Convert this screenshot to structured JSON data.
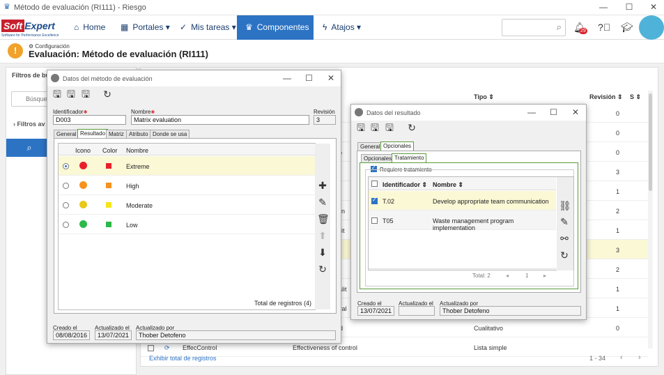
{
  "window": {
    "title": "Método de evaluación (RI111) - Riesgo",
    "minimize": "—",
    "maximize": "☐",
    "close": "✕"
  },
  "nav": {
    "logo_soft": "Soft",
    "logo_expert": "Expert",
    "logo_sub": "Software for Performance Excellence",
    "home": "Home",
    "portales": "Portales",
    "mis_tareas": "Mis tareas",
    "componentes": "Componentes",
    "atajos": "Atajos",
    "notif_count": "29"
  },
  "page": {
    "breadcrumb": "Configuración",
    "title": "Evaluación: Método de evaluación (RI111)"
  },
  "left": {
    "filters_title": "Filtros de bú",
    "search_placeholder": "Búsqued",
    "adv_filters": "Filtros av"
  },
  "grid": {
    "col_tipo": "Tipo",
    "col_revision": "Revisión",
    "col_s": "S",
    "rows": [
      {
        "tipo": "",
        "rev": "0"
      },
      {
        "tipo": "",
        "rev": "0"
      },
      {
        "tipo": "",
        "rev": "0"
      },
      {
        "tipo": "",
        "rev": "3"
      },
      {
        "tipo": "",
        "rev": "1"
      },
      {
        "tipo": "",
        "rev": "2"
      },
      {
        "tipo": "",
        "rev": "1"
      },
      {
        "tipo": "",
        "rev": "3"
      },
      {
        "tipo": "",
        "rev": "2"
      },
      {
        "tipo": "",
        "rev": "1"
      },
      {
        "tipo": "",
        "rev": "1"
      },
      {
        "tipo": "Cualitativo",
        "rev": "0"
      },
      {
        "tipo": "Lista simple",
        "rev": ""
      }
    ],
    "frag_texts": [
      "co",
      "o",
      "l",
      "on",
      "ualit",
      "eval",
      "d"
    ],
    "last_row_id": "EffecControl",
    "last_row_name": "Effectiveness of control",
    "show_total": "Exhibir total de registros",
    "paging": "1 - 34"
  },
  "dlg1": {
    "title": "Datos del método de evaluación",
    "id_label": "Identificador",
    "id_value": "D003",
    "name_label": "Nombre",
    "name_value": "Matrix evaluation",
    "rev_label": "Revisión",
    "rev_value": "3",
    "tabs": [
      "General",
      "Resultado",
      "Matriz",
      "Atributo",
      "Donde se usa"
    ],
    "cols": {
      "icono": "Icono",
      "color": "Color",
      "nombre": "Nombre"
    },
    "results": [
      {
        "name": "Extreme",
        "color": "#e8202a",
        "face": "#e8202a"
      },
      {
        "name": "High",
        "color": "#f6921e",
        "face": "#f6921e"
      },
      {
        "name": "Moderate",
        "color": "#f5e61a",
        "face": "#e8c91a"
      },
      {
        "name": "Low",
        "color": "#2db84a",
        "face": "#2db84a"
      }
    ],
    "total": "Total de registros (4)",
    "created_label": "Creado el",
    "created_value": "08/08/2016",
    "updated_label": "Actualizado el",
    "updated_value": "13/07/2021",
    "updatedby_label": "Actualizado por",
    "updatedby_value": "Thober Detofeno"
  },
  "dlg2": {
    "title": "Datos del resultado",
    "tabs": [
      "General",
      "Opcionales"
    ],
    "subtabs": [
      "Opcionales",
      "Tratamiento"
    ],
    "req_label": "Requiere tratamiento",
    "cols": {
      "id": "Identificador",
      "name": "Nombre"
    },
    "rows": [
      {
        "id": "T.02",
        "name": "Develop appropriate team communication",
        "checked": true
      },
      {
        "id": "T05",
        "name": "Waste management program implementation",
        "checked": false
      }
    ],
    "total": "Total: 2",
    "page": "1",
    "created_label": "Creado el",
    "created_value": "13/07/2021",
    "updated_label": "Actualizado el",
    "updated_value": "",
    "updatedby_label": "Actualizado por",
    "updatedby_value": "Thober Detofeno"
  }
}
